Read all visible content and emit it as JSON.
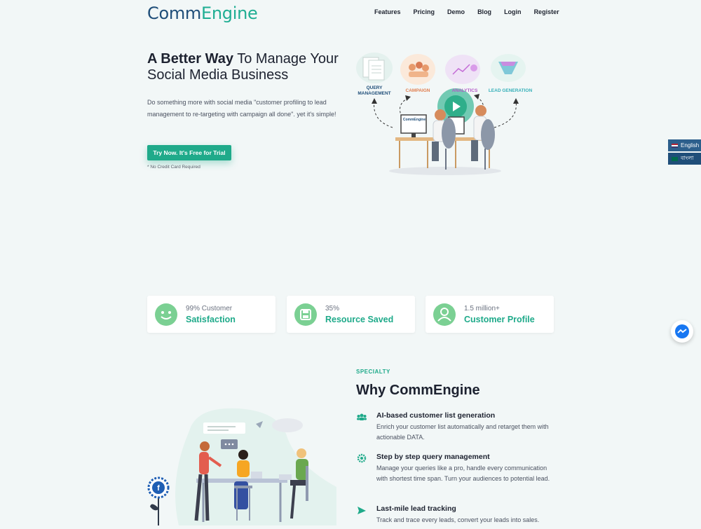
{
  "header": {
    "logo_part1": "Comm",
    "logo_part2": "Engine",
    "nav": [
      "Features",
      "Pricing",
      "Demo",
      "Blog",
      "Login",
      "Register"
    ]
  },
  "hero": {
    "title_bold": "A Better Way",
    "title_rest": " To Manage Your Social Media Business",
    "description": "Do something more with social media \"customer profiling to lead management to re-targeting with campaign all done\". yet it's simple!",
    "cta_label": "Try Now. It's Free for Trial",
    "cta_note": "* No Credit Card Required",
    "illustration_labels": {
      "query": "QUERY MANAGEMENT",
      "campaign": "CAMPAIGN",
      "analytics": "ANALYTICS",
      "lead": "LEAD GENERATION",
      "screen_logo": "CommEngine"
    }
  },
  "language": {
    "options": [
      "English",
      "বাংলা"
    ],
    "selected": "English"
  },
  "stats": [
    {
      "number": "99% Customer",
      "label": "Satisfaction",
      "icon": "smiley-icon"
    },
    {
      "number": "35%",
      "label": "Resource Saved",
      "icon": "save-icon"
    },
    {
      "number": "1.5 million+",
      "label": "Customer Profile",
      "icon": "user-icon"
    }
  ],
  "why": {
    "eyebrow": "SPECIALTY",
    "title": "Why CommEngine",
    "features": [
      {
        "title": "AI-based customer list generation",
        "desc": "Enrich your customer list automatically and retarget them with actionable DATA.",
        "icon": "users-icon"
      },
      {
        "title": "Step by step query management",
        "desc": "Manage your queries like a pro, handle every communication with shortest time span. Turn your audiences to potential lead.",
        "icon": "gear-icon"
      },
      {
        "title": "Last-mile lead tracking",
        "desc": "Track and trace every leads, convert your leads into sales.",
        "icon": "send-icon"
      }
    ]
  },
  "colors": {
    "accent": "#1faa8a",
    "brand_dark": "#1f4e79",
    "background": "#f2f7f7"
  }
}
